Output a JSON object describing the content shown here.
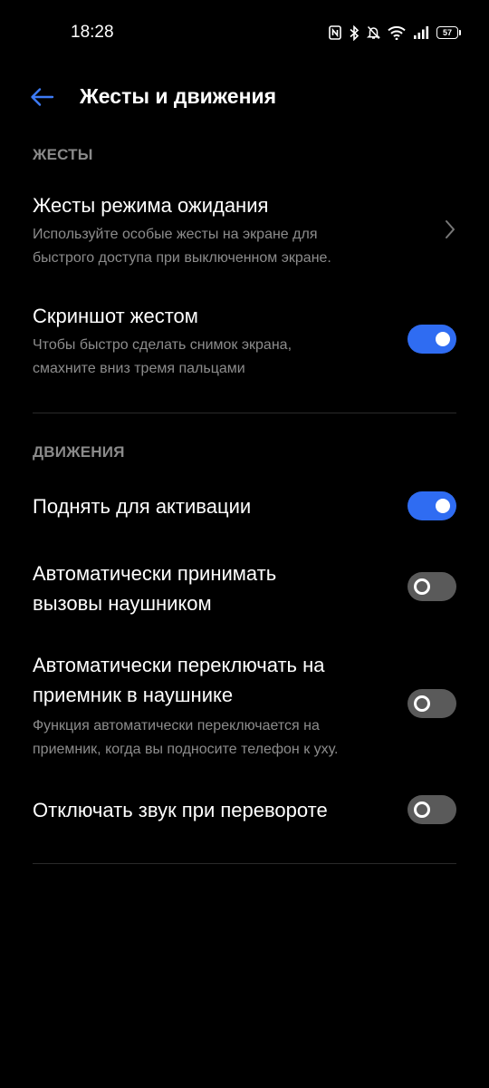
{
  "status_bar": {
    "time": "18:28",
    "icons": [
      "nfc-icon",
      "bluetooth-icon",
      "bell-off-icon",
      "wifi-icon",
      "signal-icon"
    ],
    "battery": "57"
  },
  "header": {
    "back_icon": "arrow-left-icon",
    "title": "Жесты и движения"
  },
  "sections": {
    "gestures": {
      "header": "ЖЕСТЫ",
      "standby": {
        "title": "Жесты режима ожидания",
        "subtitle_line1": "Используйте особые жесты на экране для",
        "subtitle_line2": "быстрого доступа при выключенном экране."
      },
      "screenshot": {
        "title": "Скриншот жестом",
        "subtitle_line1": "Чтобы быстро сделать снимок экрана,",
        "subtitle_line2": "смахните вниз тремя пальцами",
        "enabled": true
      }
    },
    "motions": {
      "header": "ДВИЖЕНИЯ",
      "raise_to_wake": {
        "title": "Поднять для активации",
        "enabled": true
      },
      "auto_answer": {
        "title_line1": "Автоматически принимать",
        "title_line2": "вызовы наушником",
        "enabled": false
      },
      "auto_switch": {
        "title_line1": "Автоматически переключать на",
        "title_line2": "приемник в наушнике",
        "subtitle_line1": "Функция автоматически переключается на",
        "subtitle_line2": "приемник, когда вы подносите телефон к уху.",
        "enabled": false
      },
      "flip_to_mute": {
        "title": "Отключать звук при перевороте",
        "enabled": false
      }
    }
  },
  "colors": {
    "background": "#000000",
    "accent": "#2f6cf2",
    "toggle_off": "#5a5a5a",
    "secondary_text": "#8c8c8c"
  }
}
